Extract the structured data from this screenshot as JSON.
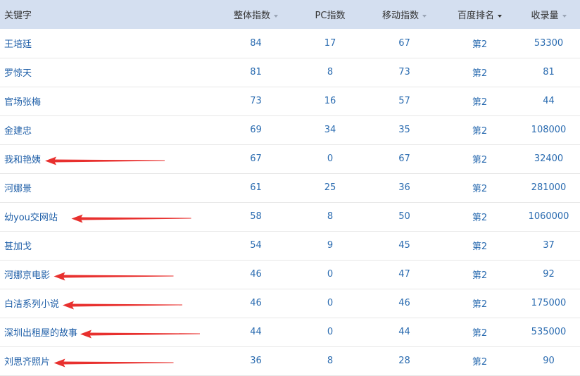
{
  "headers": {
    "keyword": "关键字",
    "overall": "整体指数",
    "pc": "PC指数",
    "mobile": "移动指数",
    "rank": "百度排名",
    "indexed": "收录量"
  },
  "rows": [
    {
      "keyword": "王培廷",
      "overall": "84",
      "pc": "17",
      "mobile": "67",
      "rank": "第2",
      "indexed": "53300"
    },
    {
      "keyword": "罗惊天",
      "overall": "81",
      "pc": "8",
      "mobile": "73",
      "rank": "第2",
      "indexed": "81"
    },
    {
      "keyword": "官场张梅",
      "overall": "73",
      "pc": "16",
      "mobile": "57",
      "rank": "第2",
      "indexed": "44"
    },
    {
      "keyword": "金建忠",
      "overall": "69",
      "pc": "34",
      "mobile": "35",
      "rank": "第2",
      "indexed": "108000"
    },
    {
      "keyword": "我和艳姨",
      "overall": "67",
      "pc": "0",
      "mobile": "67",
      "rank": "第2",
      "indexed": "32400"
    },
    {
      "keyword": "河娜景",
      "overall": "61",
      "pc": "25",
      "mobile": "36",
      "rank": "第2",
      "indexed": "281000"
    },
    {
      "keyword": "幼you交网站",
      "overall": "58",
      "pc": "8",
      "mobile": "50",
      "rank": "第2",
      "indexed": "1060000"
    },
    {
      "keyword": "甚加戈",
      "overall": "54",
      "pc": "9",
      "mobile": "45",
      "rank": "第2",
      "indexed": "37"
    },
    {
      "keyword": "河娜京电影",
      "overall": "46",
      "pc": "0",
      "mobile": "47",
      "rank": "第2",
      "indexed": "92"
    },
    {
      "keyword": "白洁系列小说",
      "overall": "46",
      "pc": "0",
      "mobile": "46",
      "rank": "第2",
      "indexed": "175000"
    },
    {
      "keyword": "深圳出租屋的故事",
      "overall": "44",
      "pc": "0",
      "mobile": "44",
      "rank": "第2",
      "indexed": "535000"
    },
    {
      "keyword": "刘思齐照片",
      "overall": "36",
      "pc": "8",
      "mobile": "28",
      "rank": "第2",
      "indexed": "90"
    }
  ],
  "annotations": {
    "arrow_color": "#e8302e",
    "arrow_rows": [
      4,
      6,
      8,
      9,
      10,
      11
    ]
  }
}
